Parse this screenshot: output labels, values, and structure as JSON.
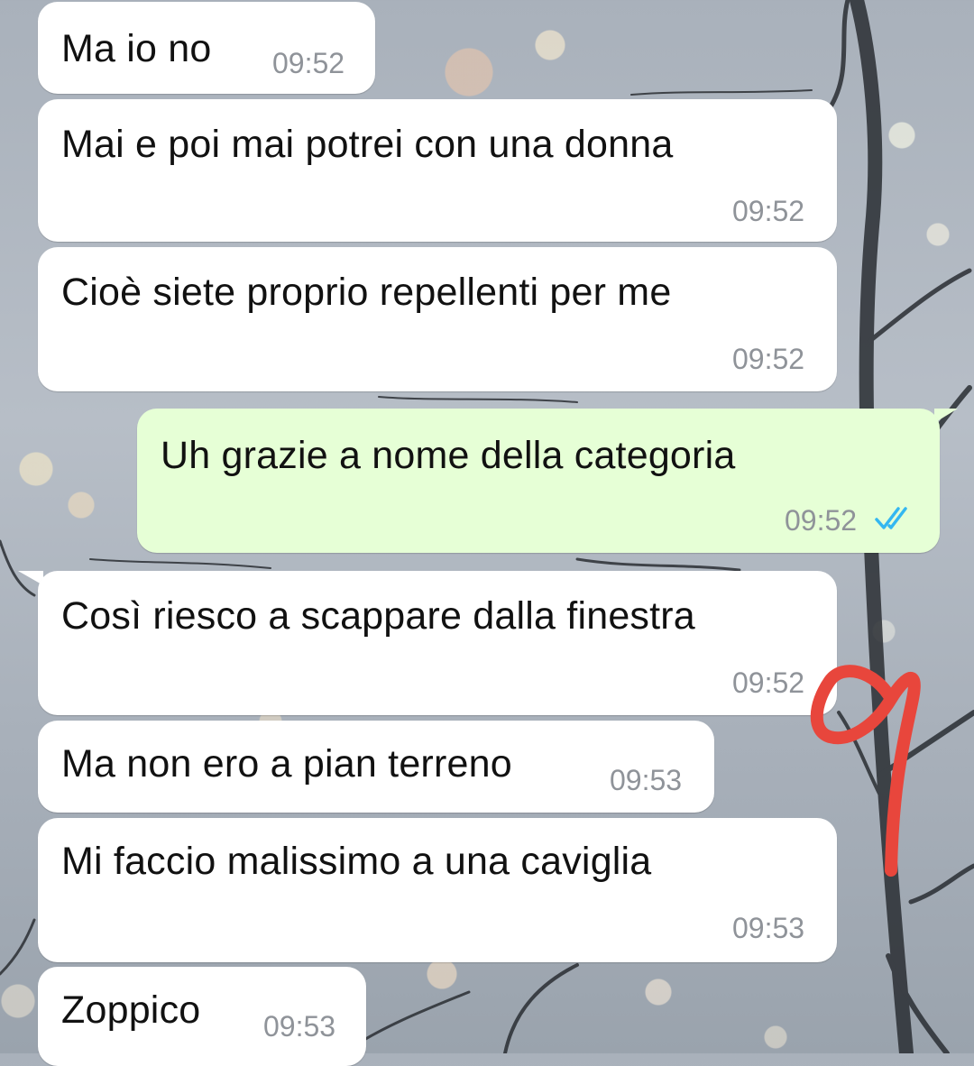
{
  "messages": [
    {
      "text": "Ma io no",
      "time": "09:52",
      "direction": "incoming"
    },
    {
      "text": "Mai e poi mai potrei con una donna",
      "time": "09:52",
      "direction": "incoming"
    },
    {
      "text": "Cioè siete proprio repellenti per me",
      "time": "09:52",
      "direction": "incoming"
    },
    {
      "text": "Uh grazie a nome della categoria",
      "time": "09:52",
      "direction": "outgoing",
      "status": "read"
    },
    {
      "text": "Così riesco a scappare dalla finestra",
      "time": "09:52",
      "direction": "incoming"
    },
    {
      "text": "Ma non ero a pian terreno",
      "time": "09:53",
      "direction": "incoming"
    },
    {
      "text": "Mi faccio malissimo a una caviglia",
      "time": "09:53",
      "direction": "incoming"
    },
    {
      "text": "Zoppico",
      "time": "09:53",
      "direction": "incoming"
    }
  ],
  "annotation": {
    "text": "9",
    "color": "#e8463c"
  },
  "colors": {
    "incoming_bubble": "#ffffff",
    "outgoing_bubble": "#e6ffd6",
    "read_ticks": "#34b7f1",
    "time_text": "#8f9399"
  },
  "icons": {
    "read_receipt": "double-check-icon"
  }
}
